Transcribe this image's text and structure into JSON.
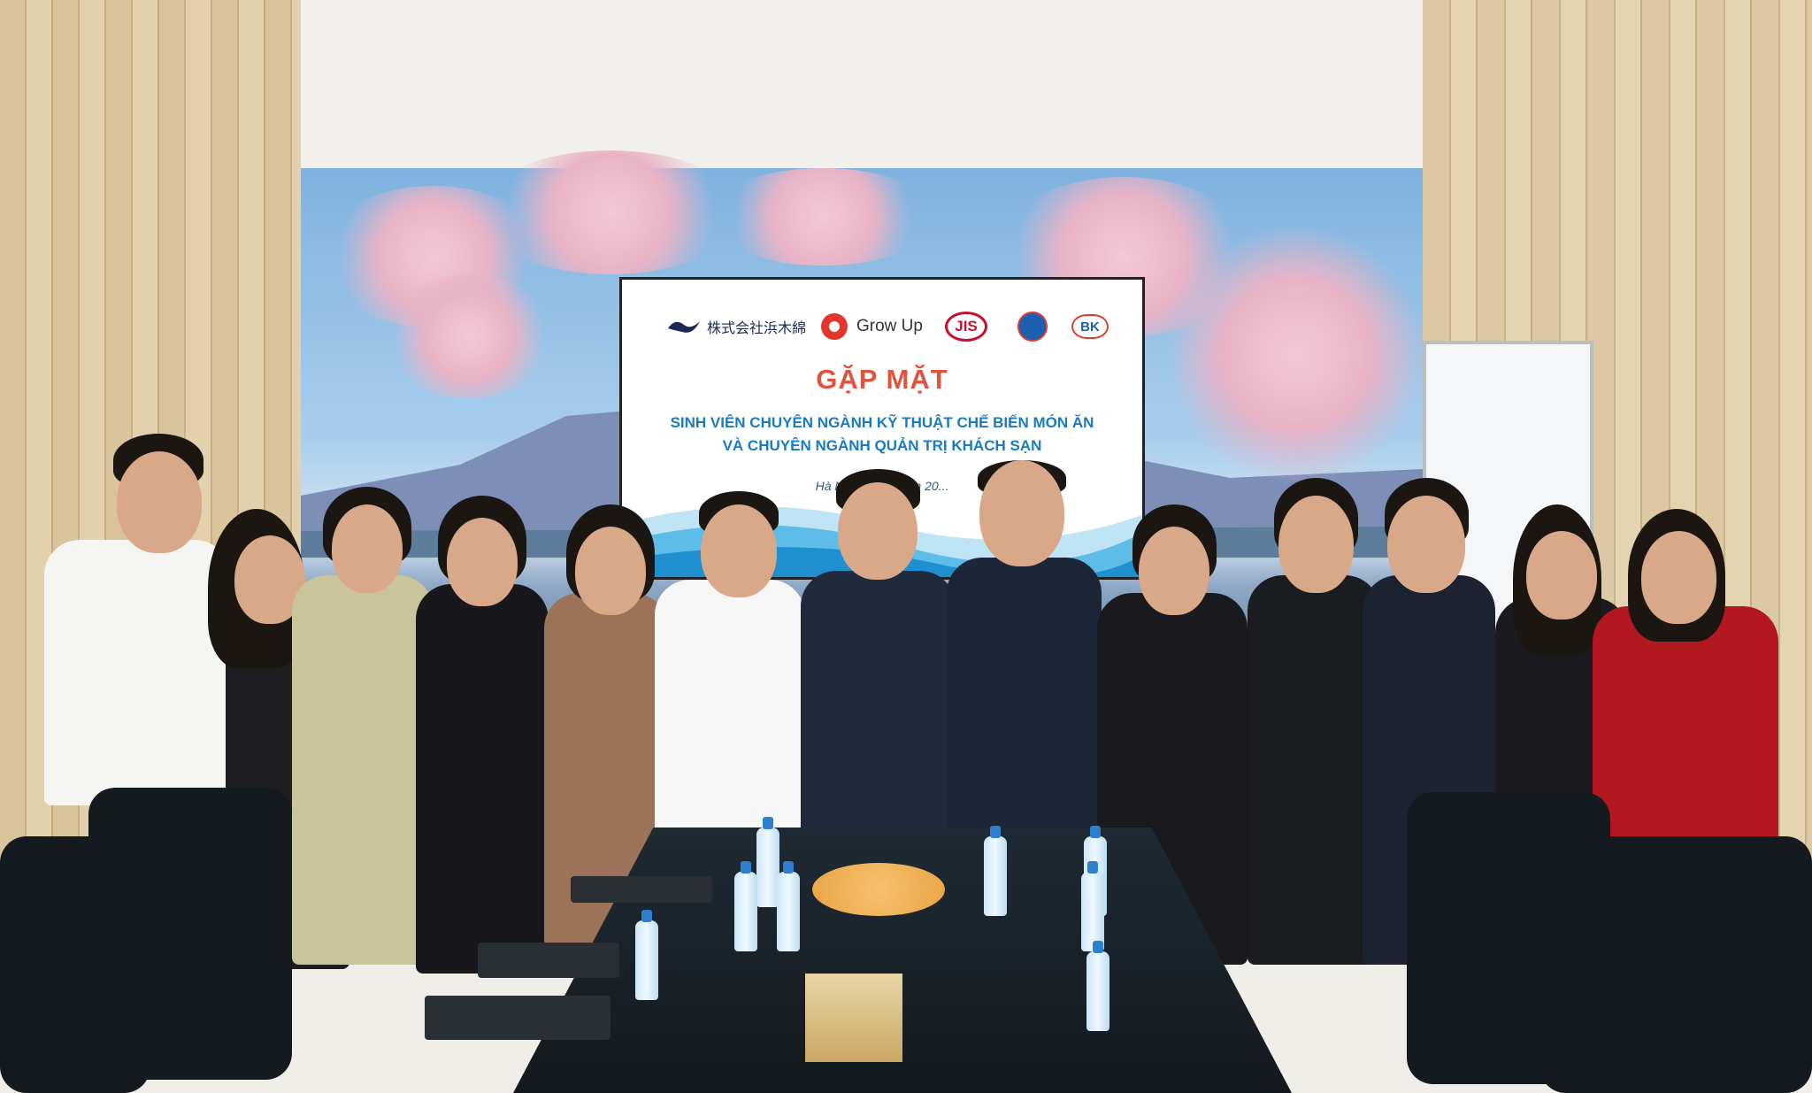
{
  "screen": {
    "logo_hamamen": "株式会社浜木綿",
    "logo_growup": "Grow Up",
    "logo_jis": "JIS",
    "logo_bk": "BK",
    "title": "GẶP MẶT",
    "subtitle_line1": "SINH VIÊN CHUYÊN NGÀNH KỸ THUẬT CHẾ BIẾN MÓN ĂN",
    "subtitle_line2": "VÀ CHUYÊN NGÀNH QUẢN TRỊ KHÁCH SẠN",
    "date_line": "Hà Nội, n... 11 năm 20..."
  },
  "colors": {
    "title": "#e0533f",
    "subtitle": "#1a7bbf",
    "growup_red": "#e2362b",
    "jis_red": "#c8102e"
  },
  "icons": [
    "hamamen-logo-icon",
    "growup-logo-icon",
    "jis-logo-icon",
    "school-emblem-icon",
    "bk-logo-icon"
  ]
}
